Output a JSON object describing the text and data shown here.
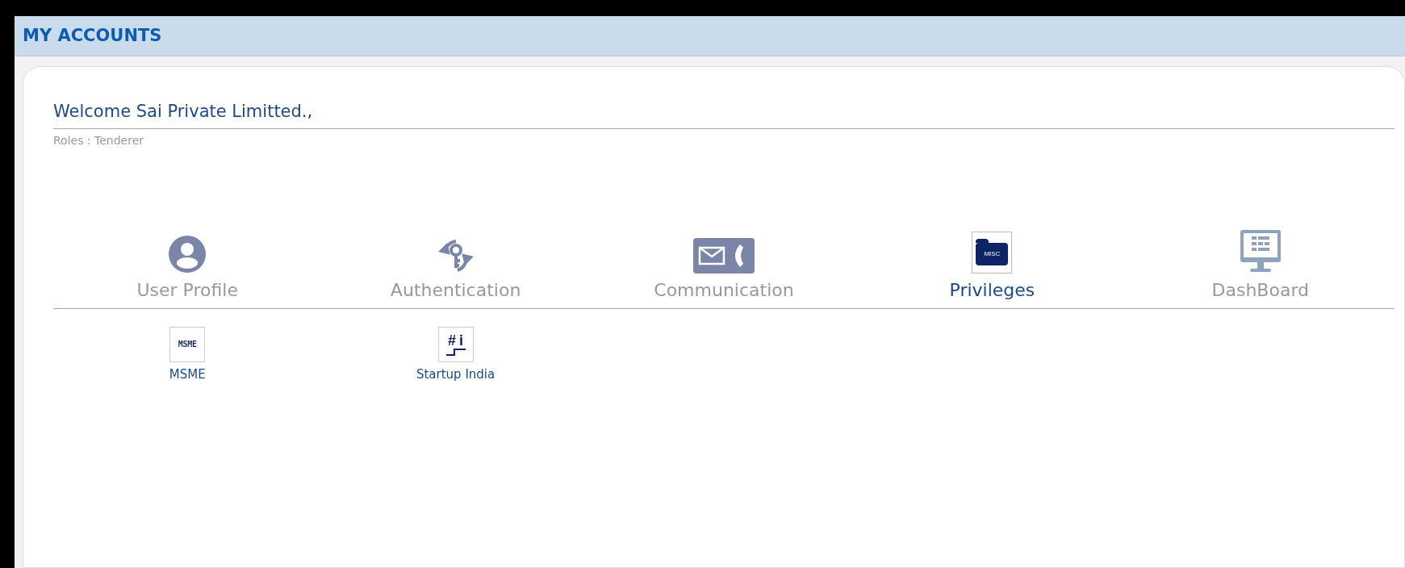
{
  "header": {
    "title": "MY ACCOUNTS"
  },
  "welcome": {
    "title": "Welcome Sai Private Limitted.,",
    "roles": "Roles : Tenderer"
  },
  "tabs": [
    {
      "label": "User Profile",
      "kind": "user",
      "selected": false
    },
    {
      "label": "Authentication",
      "kind": "key",
      "selected": false
    },
    {
      "label": "Communication",
      "kind": "mail",
      "selected": false
    },
    {
      "label": "Privileges",
      "kind": "folder",
      "icon_text": "MISC",
      "selected": true
    },
    {
      "label": "DashBoard",
      "kind": "monitor",
      "selected": false
    }
  ],
  "items": [
    {
      "label": "MSME",
      "kind": "msme",
      "logo_text": "MSME"
    },
    {
      "label": "Startup India",
      "kind": "startup",
      "logo_text": "#",
      "logo_text_2": "i"
    }
  ]
}
